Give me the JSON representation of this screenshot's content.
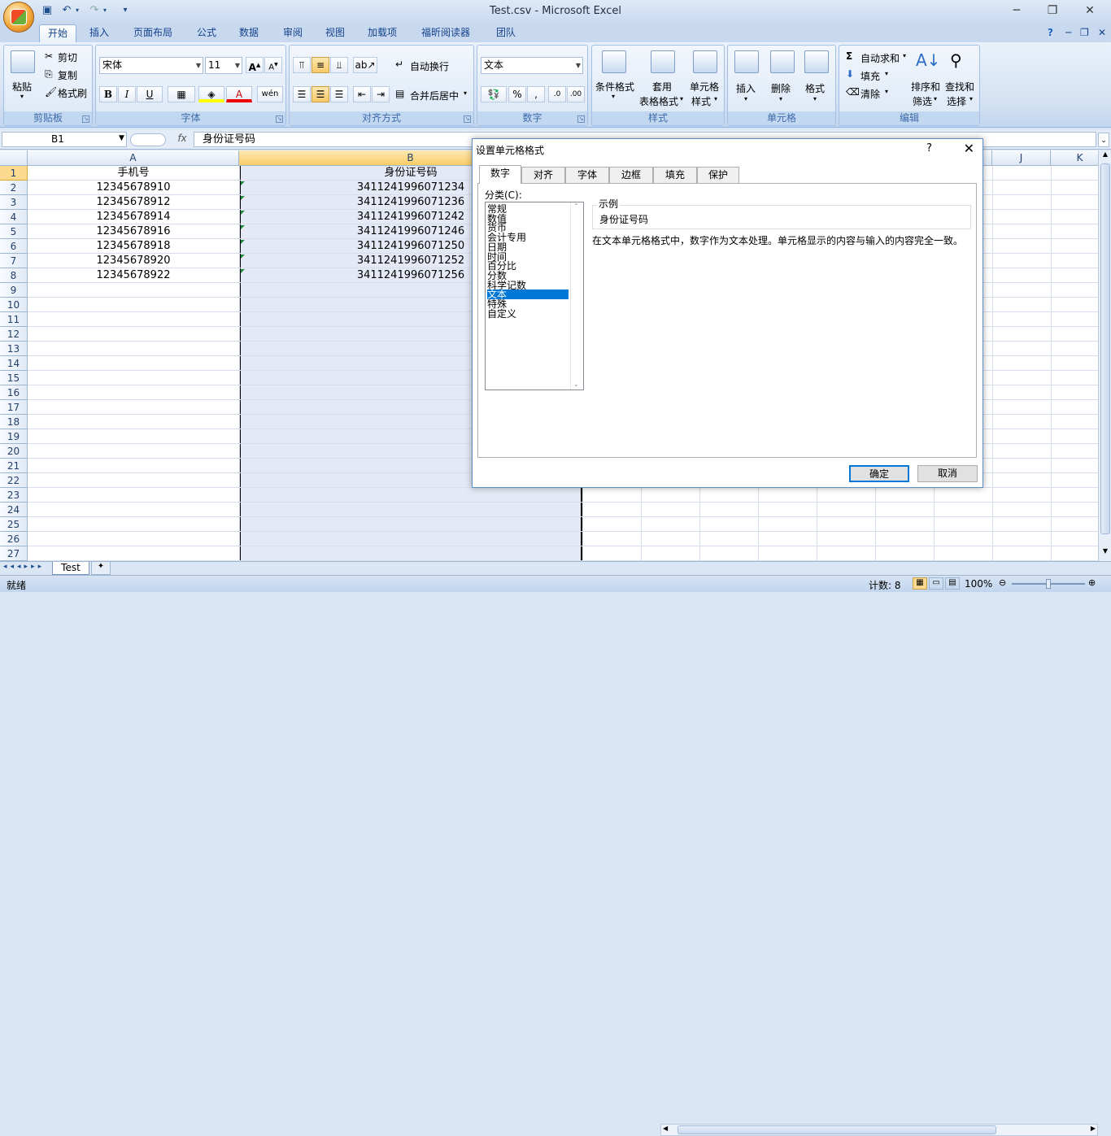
{
  "window": {
    "title": "Test.csv - Microsoft Excel"
  },
  "ribbon_tabs": [
    "开始",
    "插入",
    "页面布局",
    "公式",
    "数据",
    "审阅",
    "视图",
    "加载项",
    "福昕阅读器",
    "团队"
  ],
  "clipboard": {
    "paste": "粘贴",
    "cut": "剪切",
    "copy": "复制",
    "format_painter": "格式刷",
    "label": "剪贴板"
  },
  "font": {
    "name": "宋体",
    "size": "11",
    "bold": "B",
    "italic": "I",
    "underline": "U",
    "label": "字体"
  },
  "alignment": {
    "wrap": "自动换行",
    "merge": "合并后居中",
    "label": "对齐方式"
  },
  "number": {
    "format": "文本",
    "percent": "%",
    "comma": ",",
    "label": "数字"
  },
  "styles": {
    "conditional": "条件格式",
    "table": "套用",
    "table2": "表格格式",
    "cell": "单元格",
    "cell2": "样式",
    "label": "样式"
  },
  "cells": {
    "insert": "插入",
    "delete": "删除",
    "format": "格式",
    "label": "单元格"
  },
  "editing": {
    "autosum": "自动求和",
    "fill": "填充",
    "clear": "清除",
    "sort": "排序和",
    "sort2": "筛选",
    "find": "查找和",
    "find2": "选择",
    "label": "编辑"
  },
  "formula_bar": {
    "name_box": "B1",
    "fx": "fx",
    "content": "身份证号码"
  },
  "columns": [
    "A",
    "B",
    "J",
    "K"
  ],
  "rows": [
    "1",
    "2",
    "3",
    "4",
    "5",
    "6",
    "7",
    "8",
    "9",
    "10",
    "11",
    "12",
    "13",
    "14",
    "15",
    "16",
    "17",
    "18",
    "19",
    "20",
    "21",
    "22",
    "23",
    "24",
    "25",
    "26",
    "27"
  ],
  "cells_data": {
    "headers": [
      "手机号",
      "身份证号码"
    ],
    "phones": [
      "12345678910",
      "12345678912",
      "12345678914",
      "12345678916",
      "12345678918",
      "12345678920",
      "12345678922"
    ],
    "ids": [
      "3411241996071234",
      "3411241996071236",
      "3411241996071242",
      "3411241996071246",
      "3411241996071250",
      "3411241996071252",
      "3411241996071256"
    ]
  },
  "sheet_tab": "Test",
  "status": {
    "ready": "就绪",
    "count": "计数: 8",
    "zoom": "100%"
  },
  "dialog": {
    "title": "设置单元格格式",
    "help": "?",
    "tabs": [
      "数字",
      "对齐",
      "字体",
      "边框",
      "填充",
      "保护"
    ],
    "category_label": "分类(C):",
    "categories": [
      "常规",
      "数值",
      "货币",
      "会计专用",
      "日期",
      "时间",
      "百分比",
      "分数",
      "科学记数",
      "文本",
      "特殊",
      "自定义"
    ],
    "selected_category": "文本",
    "sample_label": "示例",
    "sample_value": "身份证号码",
    "description": "在文本单元格格式中，数字作为文本处理。单元格显示的内容与输入的内容完全一致。",
    "ok": "确定",
    "cancel": "取消"
  },
  "colors": {
    "accent": "#0078d7",
    "ribbon_text": "#15428b",
    "selection_fill": "#e4e9f5"
  }
}
